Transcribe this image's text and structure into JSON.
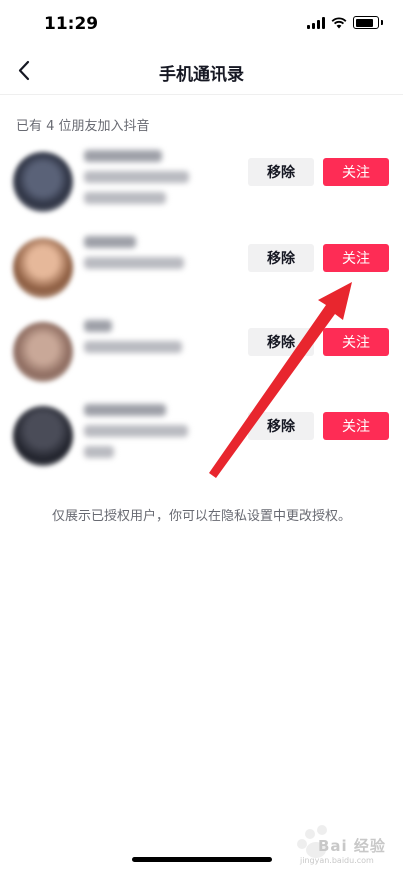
{
  "status_bar": {
    "time": "11:29"
  },
  "nav": {
    "title": "手机通讯录"
  },
  "section": {
    "header": "已有 4 位朋友加入抖音"
  },
  "friends": [
    {
      "remove_label": "移除",
      "follow_label": "关注"
    },
    {
      "remove_label": "移除",
      "follow_label": "关注"
    },
    {
      "remove_label": "移除",
      "follow_label": "关注"
    },
    {
      "remove_label": "移除",
      "follow_label": "关注"
    }
  ],
  "footnote": "仅展示已授权用户，你可以在隐私设置中更改授权。",
  "watermark": {
    "text": "Bai 经验",
    "sub": "jingyan.baidu.com"
  },
  "colors": {
    "follow": "#fe2c55",
    "remove_bg": "#f1f1f2",
    "arrow": "#e8262e",
    "text_secondary": "#686a72"
  }
}
